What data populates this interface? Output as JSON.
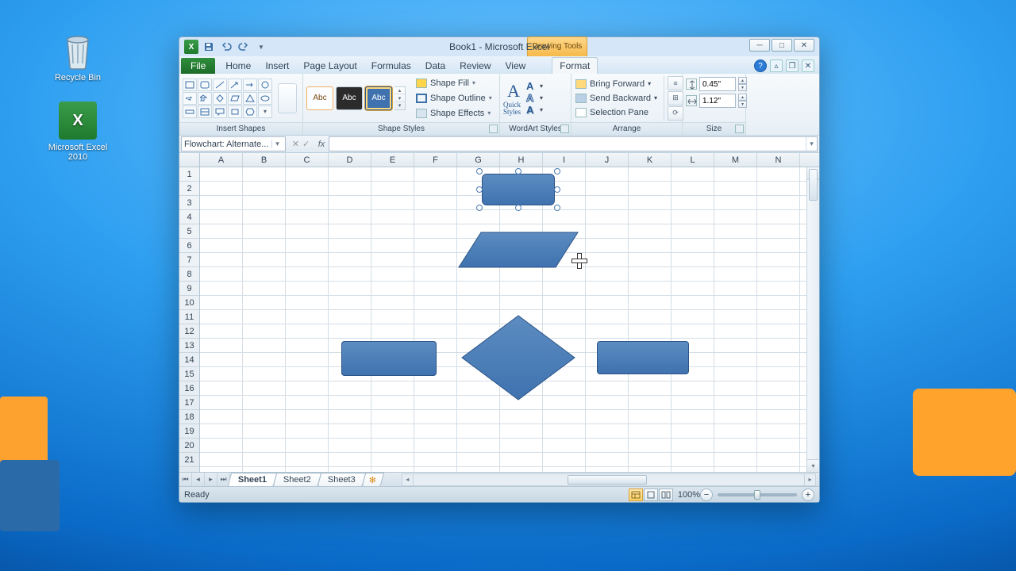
{
  "desktop": {
    "recyclebin": "Recycle Bin",
    "excel": "Microsoft Excel 2010"
  },
  "titlebar": {
    "title": "Book1 - Microsoft Excel",
    "context_tab": "Drawing Tools"
  },
  "tabs": {
    "file": "File",
    "home": "Home",
    "insert": "Insert",
    "pagelayout": "Page Layout",
    "formulas": "Formulas",
    "data": "Data",
    "review": "Review",
    "view": "View",
    "format": "Format"
  },
  "ribbon": {
    "insert_shapes": "Insert Shapes",
    "shape_styles": "Shape Styles",
    "shape_fill": "Shape Fill",
    "shape_outline": "Shape Outline",
    "shape_effects": "Shape Effects",
    "abc": "Abc",
    "wordart_styles": "WordArt Styles",
    "quick_styles": "Quick Styles",
    "arrange": "Arrange",
    "bring_forward": "Bring Forward",
    "send_backward": "Send Backward",
    "selection_pane": "Selection Pane",
    "size": "Size",
    "height": "0.45\"",
    "width": "1.12\""
  },
  "namebox": "Flowchart: Alternate...",
  "columns": [
    "A",
    "B",
    "C",
    "D",
    "E",
    "F",
    "G",
    "H",
    "I",
    "J",
    "K",
    "L",
    "M",
    "N"
  ],
  "rows": [
    "1",
    "2",
    "3",
    "4",
    "5",
    "6",
    "7",
    "8",
    "9",
    "10",
    "11",
    "12",
    "13",
    "14",
    "15",
    "16",
    "17",
    "18",
    "19",
    "20",
    "21"
  ],
  "sheets": {
    "s1": "Sheet1",
    "s2": "Sheet2",
    "s3": "Sheet3"
  },
  "status": {
    "ready": "Ready",
    "zoom": "100%"
  }
}
